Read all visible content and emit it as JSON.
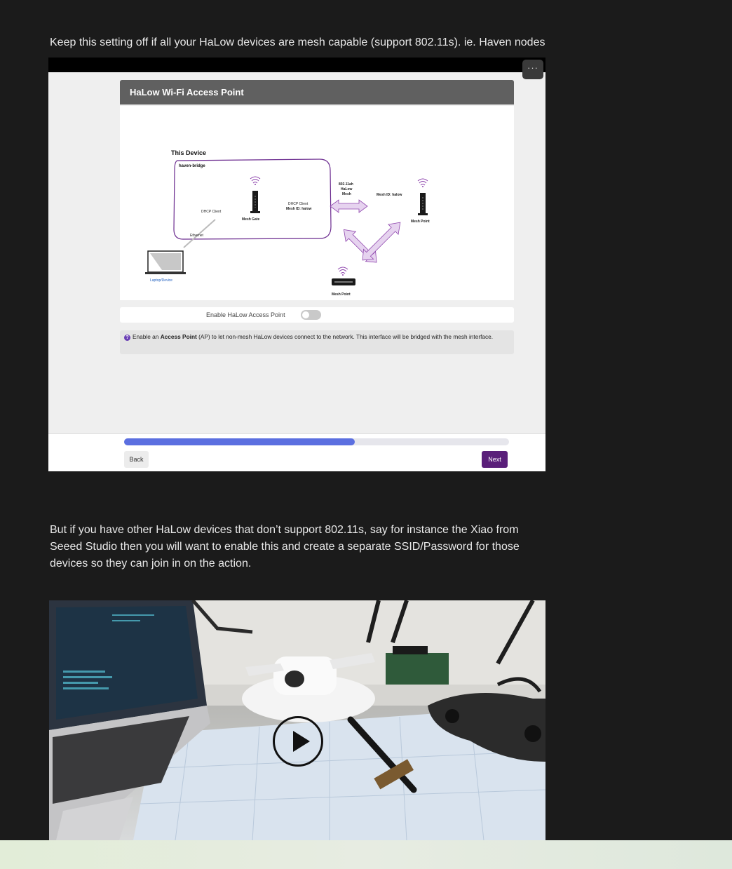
{
  "paragraphs": {
    "p1": "Keep this setting off if all your HaLow devices are mesh capable (support 802.11s). ie. Haven nodes",
    "p2": "But if you have other HaLow devices that don’t support 802.11s, say for instance the Xiao from Seeed Studio then you will want to enable this and create a separate SSID/Password for those devices so they can join in on the action."
  },
  "embed": {
    "more_label": "···",
    "card_title": "HaLow Wi-Fi Access Point",
    "diagram": {
      "this_device": "This Device",
      "hostname": "haven-bridge",
      "dhcp_client": "DHCP Client",
      "ethernet": "Ethernet",
      "laptop": "Laptop/Device",
      "mesh_gate": "Mesh Gate",
      "dhcp_client_2": "DHCP Client",
      "mesh_id_1": "Mesh ID: halow",
      "link_l1": "802.11ah",
      "link_l2": "HaLow",
      "link_l3": "Mesh",
      "mesh_id_2": "Mesh ID: halow",
      "mesh_point_right": "Mesh Point",
      "mesh_point_bottom": "Mesh Point"
    },
    "toggle_label": "Enable HaLow Access Point",
    "toggle_on": false,
    "info_pre": "Enable an ",
    "info_bold": "Access Point",
    "info_post": " (AP) to let non-mesh HaLow devices connect to the network. This interface will be bridged with the mesh interface.",
    "progress_fraction": 0.6,
    "back_label": "Back",
    "next_label": "Next",
    "colors": {
      "accent": "#5a1f7a",
      "progress": "#5b6fe0",
      "header": "#606060",
      "mesh_icon": "#8e44ad"
    }
  },
  "video": {
    "play_icon": "play-icon"
  }
}
